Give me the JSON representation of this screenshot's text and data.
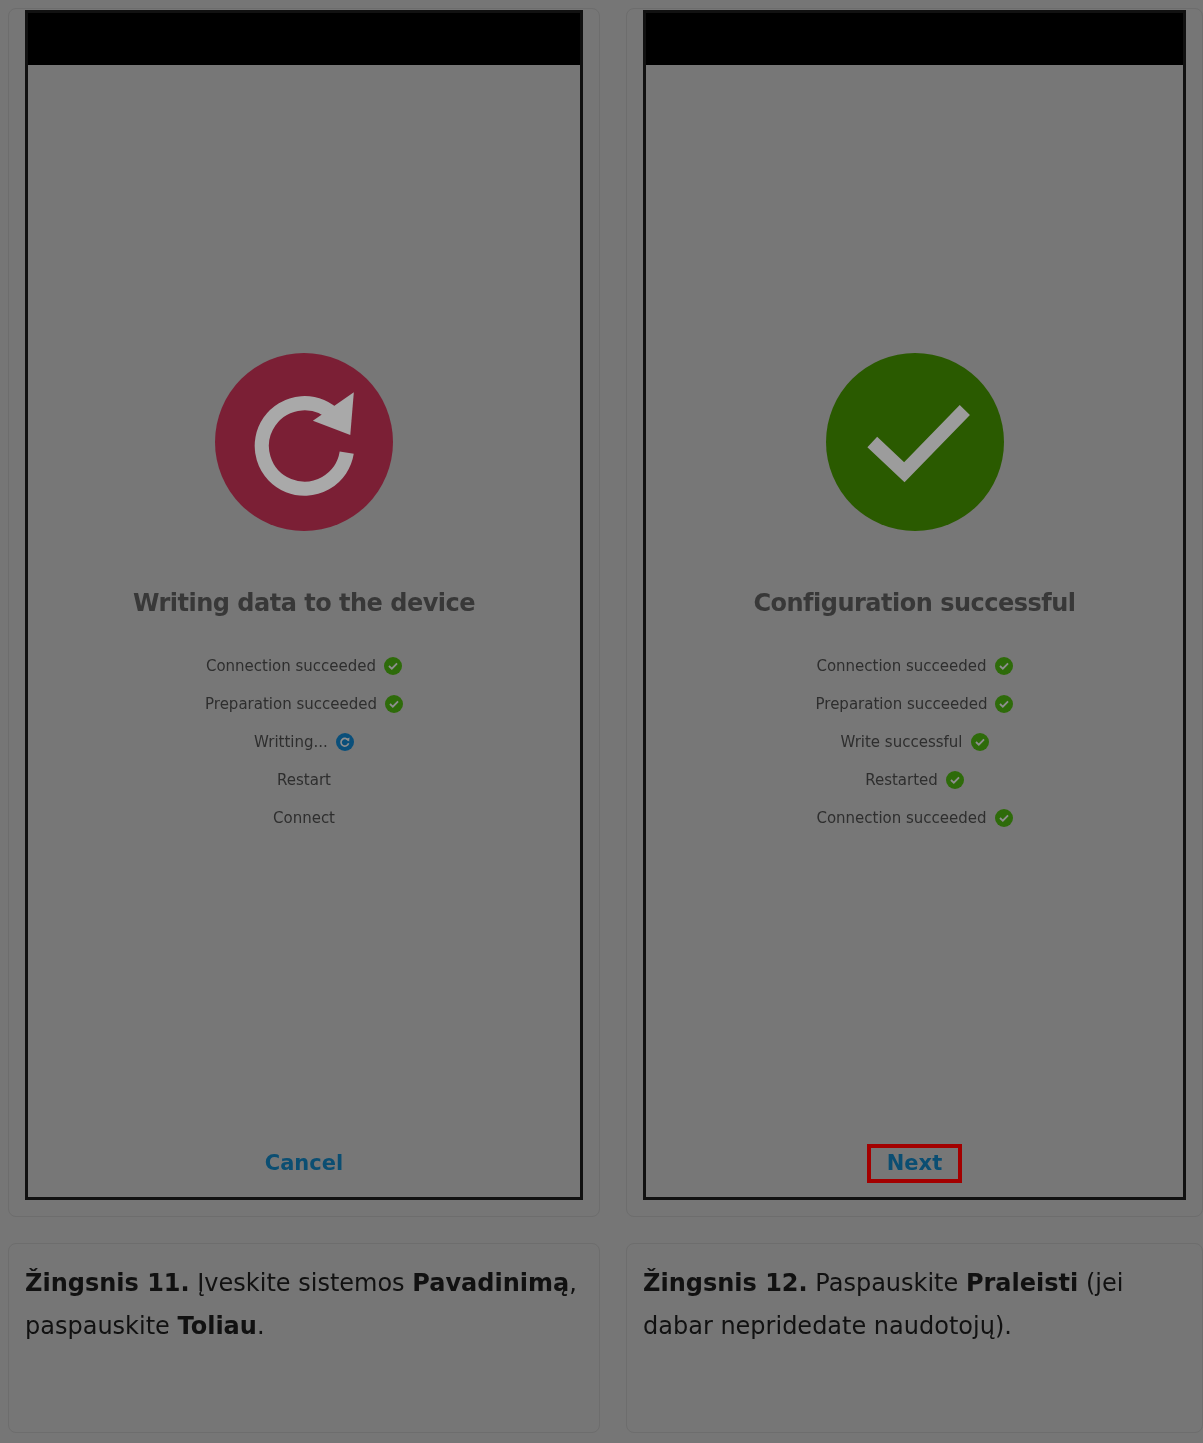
{
  "panels": [
    {
      "phone": {
        "status_icon": {
          "kind": "refresh"
        },
        "title": "Writing data to the device",
        "steps": [
          {
            "label": "Connection succeeded",
            "done": true,
            "in_progress": false
          },
          {
            "label": "Preparation succeeded",
            "done": true,
            "in_progress": false
          },
          {
            "label": "Writting...",
            "done": false,
            "in_progress": true
          },
          {
            "label": "Restart",
            "done": false,
            "in_progress": false
          },
          {
            "label": "Connect",
            "done": false,
            "in_progress": false
          }
        ],
        "button": {
          "label": "Cancel",
          "highlighted": false
        }
      },
      "caption": "**Žingsnis 11.** Įveskite sistemos **Pavadinimą**, paspauskite **Toliau**."
    },
    {
      "phone": {
        "status_icon": {
          "kind": "check"
        },
        "title": "Configuration successful",
        "steps": [
          {
            "label": "Connection succeeded",
            "done": true,
            "in_progress": false
          },
          {
            "label": "Preparation succeeded",
            "done": true,
            "in_progress": false
          },
          {
            "label": "Write successful",
            "done": true,
            "in_progress": false
          },
          {
            "label": "Restarted",
            "done": true,
            "in_progress": false
          },
          {
            "label": "Connection succeeded",
            "done": true,
            "in_progress": false
          }
        ],
        "button": {
          "label": "Next",
          "highlighted": true
        }
      },
      "caption": "**Žingsnis 12.** Paspauskite **Praleisti** (jei dabar nepridedate naudotojų)."
    }
  ]
}
